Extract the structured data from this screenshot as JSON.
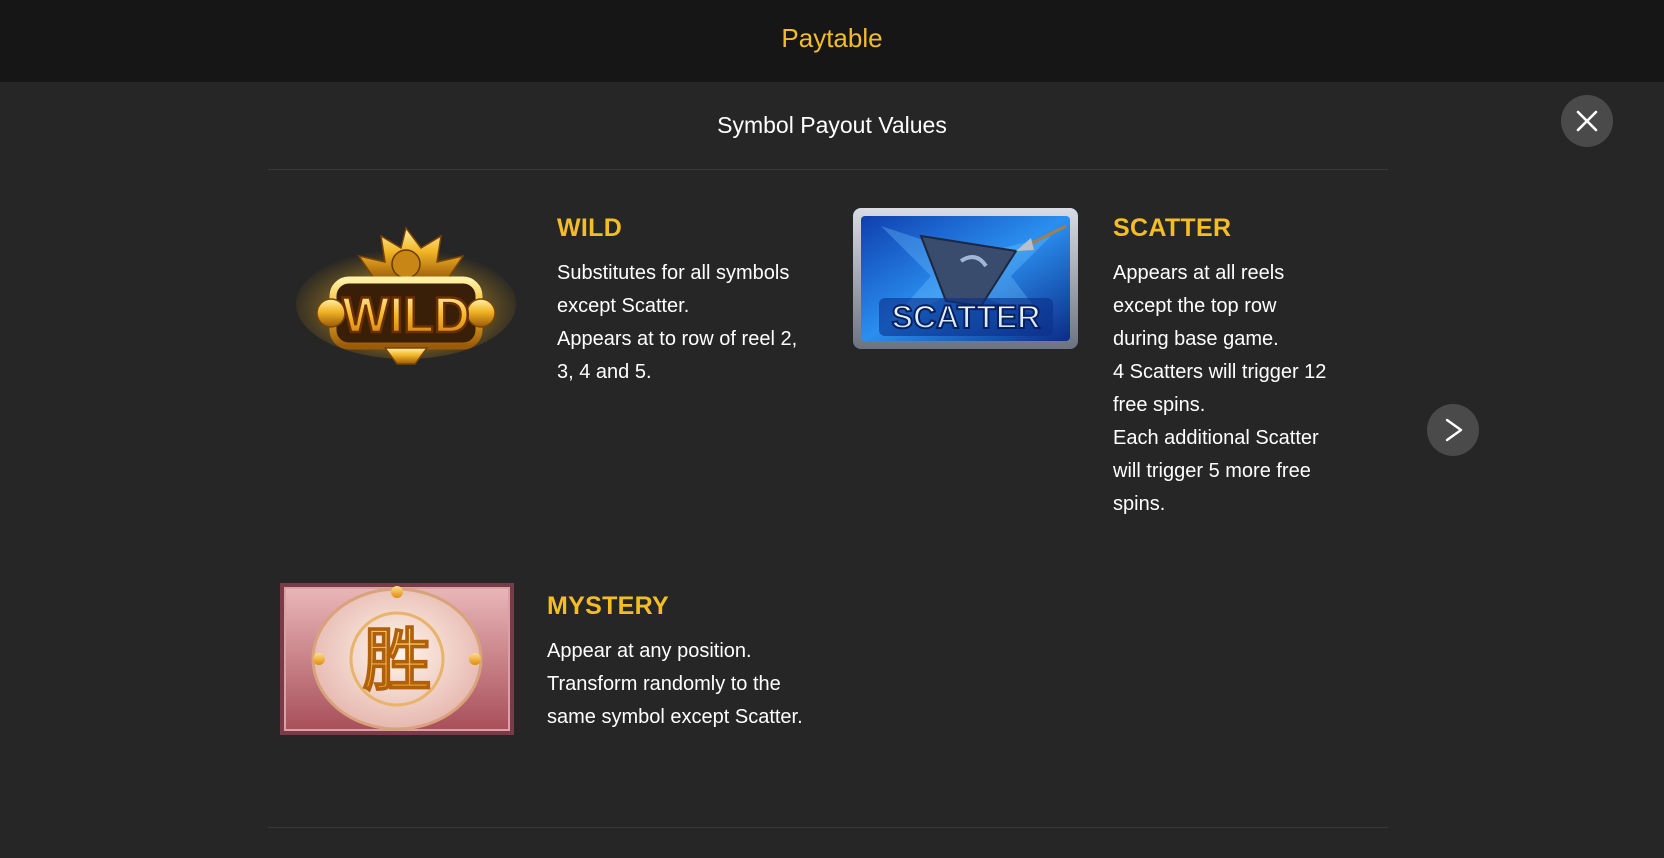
{
  "header": {
    "title": "Paytable"
  },
  "section": {
    "title": "Symbol Payout Values"
  },
  "symbols": {
    "wild": {
      "name": "WILD",
      "image_label": "WILD",
      "lines": [
        "Substitutes for all symbols",
        "except Scatter.",
        "Appears at to row of reel 2,",
        "3, 4 and 5."
      ]
    },
    "scatter": {
      "name": "SCATTER",
      "image_label": "SCATTER",
      "lines": [
        "Appears at all reels",
        "except the top row",
        "during base game.",
        "4 Scatters will trigger 12",
        "free spins.",
        "Each additional Scatter",
        "will trigger 5 more free",
        "spins."
      ]
    },
    "mystery": {
      "name": "MYSTERY",
      "image_label": "胜",
      "lines": [
        "Appear at any position.",
        "Transform randomly to the",
        "same symbol except Scatter."
      ]
    }
  },
  "icons": {
    "close": "close-icon",
    "next": "chevron-right-icon"
  },
  "colors": {
    "accent": "#f5bd25",
    "background": "#262626",
    "header_bg": "#161616",
    "button_bg": "#4a4a4a"
  }
}
